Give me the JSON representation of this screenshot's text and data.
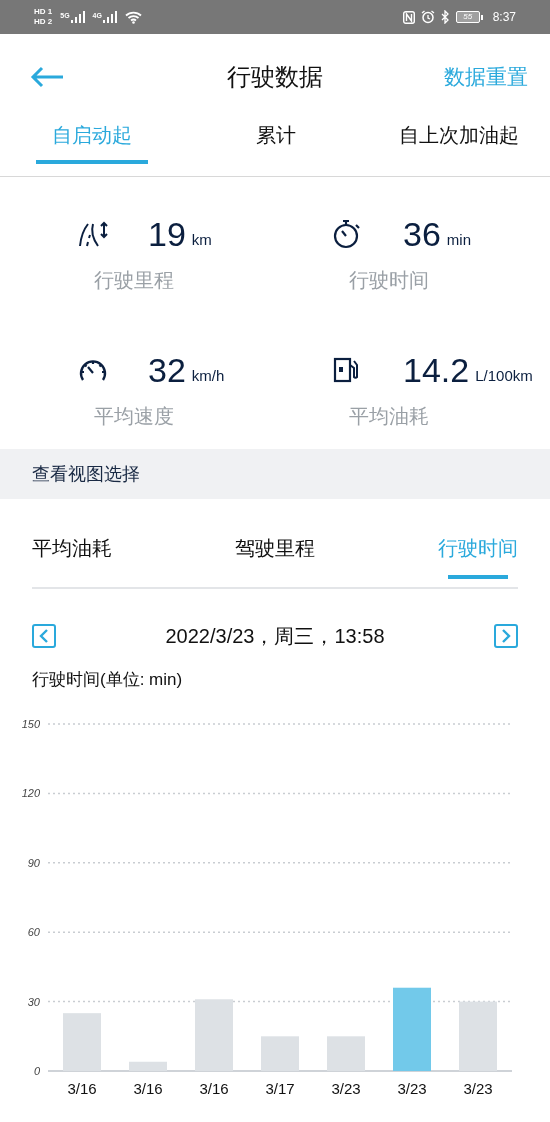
{
  "status_bar": {
    "sim_1": "HD 1",
    "sim_2": "HD 2",
    "network_1": "5G",
    "network_2": "4G",
    "battery": "55",
    "time": "8:37"
  },
  "header": {
    "title": "行驶数据",
    "action": "数据重置"
  },
  "tabs": [
    {
      "label": "自启动起",
      "selected": true
    },
    {
      "label": "累计",
      "selected": false
    },
    {
      "label": "自上次加油起",
      "selected": false
    }
  ],
  "stats": [
    {
      "kind": "distance",
      "value": "19",
      "unit": "km",
      "label": "行驶里程"
    },
    {
      "kind": "time",
      "value": "36",
      "unit": "min",
      "label": "行驶时间"
    },
    {
      "kind": "speed",
      "value": "32",
      "unit": "km/h",
      "label": "平均速度"
    },
    {
      "kind": "fuel",
      "value": "14.2",
      "unit": "L/100km",
      "label": "平均油耗"
    }
  ],
  "view_section": {
    "title": "查看视图选择"
  },
  "view_tabs": [
    {
      "label": "平均油耗",
      "selected": false
    },
    {
      "label": "驾驶里程",
      "selected": false
    },
    {
      "label": "行驶时间",
      "selected": true
    }
  ],
  "date_nav": {
    "date": "2022/3/23，周三，13:58"
  },
  "chart": {
    "title": "行驶时间(单位: min)",
    "chart_data": {
      "type": "bar",
      "categories": [
        "3/16",
        "3/16",
        "3/16",
        "3/17",
        "3/23",
        "3/23",
        "3/23"
      ],
      "series": [
        {
          "color": "#dde1e5",
          "values": [
            25,
            4,
            31,
            15,
            15,
            null,
            30
          ]
        },
        {
          "color": "#72c9ea",
          "values": [
            null,
            null,
            null,
            null,
            null,
            36,
            null
          ]
        }
      ],
      "grid": true,
      "ylim": [
        0,
        150
      ],
      "yticks": [
        0,
        30,
        60,
        90,
        120,
        150
      ]
    }
  }
}
